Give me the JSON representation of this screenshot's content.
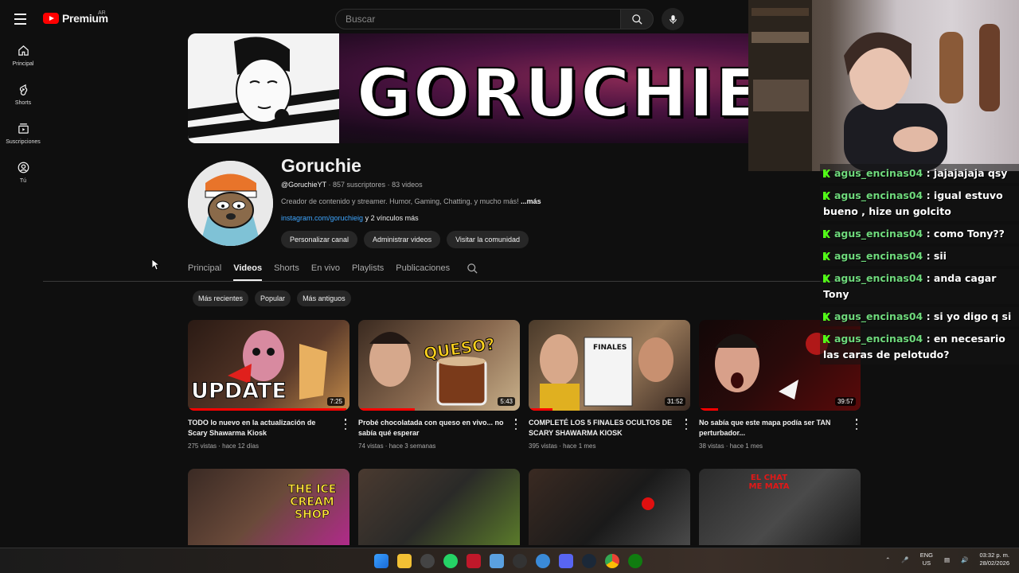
{
  "header": {
    "logo_text": "Premium",
    "country_code": "AR",
    "search_placeholder": "Buscar"
  },
  "sidebar": {
    "items": [
      {
        "label": "Principal",
        "icon": "home-icon"
      },
      {
        "label": "Shorts",
        "icon": "shorts-icon"
      },
      {
        "label": "Suscripciones",
        "icon": "subscriptions-icon"
      },
      {
        "label": "Tú",
        "icon": "account-icon"
      }
    ]
  },
  "banner": {
    "title": "GORUCHIE"
  },
  "channel": {
    "name": "Goruchie",
    "handle": "@GoruchieYT",
    "subscribers": "857 suscriptores",
    "videos_count": "83 videos",
    "description": "Creador de contenido y streamer. Humor, Gaming, Chatting,  y mucho más!",
    "more": "...más",
    "link": "instagram.com/goruchieig",
    "more_links": "y 2 vínculos más",
    "buttons": [
      "Personalizar canal",
      "Administrar videos",
      "Visitar la comunidad"
    ]
  },
  "tabs": [
    "Principal",
    "Videos",
    "Shorts",
    "En vivo",
    "Playlists",
    "Publicaciones"
  ],
  "active_tab": "Videos",
  "filters": [
    "Más recientes",
    "Popular",
    "Más antiguos"
  ],
  "videos": [
    {
      "title": "TODO lo nuevo en la actualización de Scary Shawarma Kiosk",
      "views": "275 vistas",
      "age": "hace 12 días",
      "duration": "7:25",
      "thumb_text": "UPDATE",
      "watched": 0.98
    },
    {
      "title": "Probé chocolatada con queso en vivo... no sabía qué esperar",
      "views": "74 vistas",
      "age": "hace 3 semanas",
      "duration": "5:43",
      "thumb_text": "QUESO?",
      "watched": 0.35
    },
    {
      "title": "COMPLETÉ LOS 5 FINALES OCULTOS DE SCARY SHAWARMA KIOSK",
      "views": "395 vistas",
      "age": "hace 1 mes",
      "duration": "31:52",
      "thumb_text": "FINALES",
      "watched": 0.15
    },
    {
      "title": "No sabía que este mapa podía ser TAN perturbador...",
      "views": "38 vistas",
      "age": "hace 1 mes",
      "duration": "39:57",
      "thumb_text": "",
      "watched": 0.12
    }
  ],
  "videos_row2": [
    {
      "thumb_text": "THE ICE CREAM SHOP"
    },
    {
      "thumb_text": ""
    },
    {
      "thumb_text": ""
    },
    {
      "thumb_text": "EL CHAT ME MATA"
    }
  ],
  "chat": [
    {
      "user": "agus_encinas04",
      "text": ": jajajajaja qsy"
    },
    {
      "user": "agus_encinas04",
      "text": ": igual estuvo bueno , hize un golcito"
    },
    {
      "user": "agus_encinas04",
      "text": ": como Tony??"
    },
    {
      "user": "agus_encinas04",
      "text": ": sii"
    },
    {
      "user": "agus_encinas04",
      "text": ": anda cagar Tony"
    },
    {
      "user": "agus_encinas04",
      "text": ": si yo digo q si"
    },
    {
      "user": "agus_encinas04",
      "text": ": en necesario las caras de pelotudo?"
    }
  ],
  "taskbar": {
    "lang_top": "ENG",
    "lang_bottom": "US",
    "time": "03:32 p. m.",
    "date": "28/02/2026"
  },
  "colors": {
    "background": "#0f0f0f",
    "accent_red": "#ff0000",
    "link_blue": "#3ea6ff",
    "chat_user": "#6fd97c",
    "kick_green": "#53fc18"
  }
}
